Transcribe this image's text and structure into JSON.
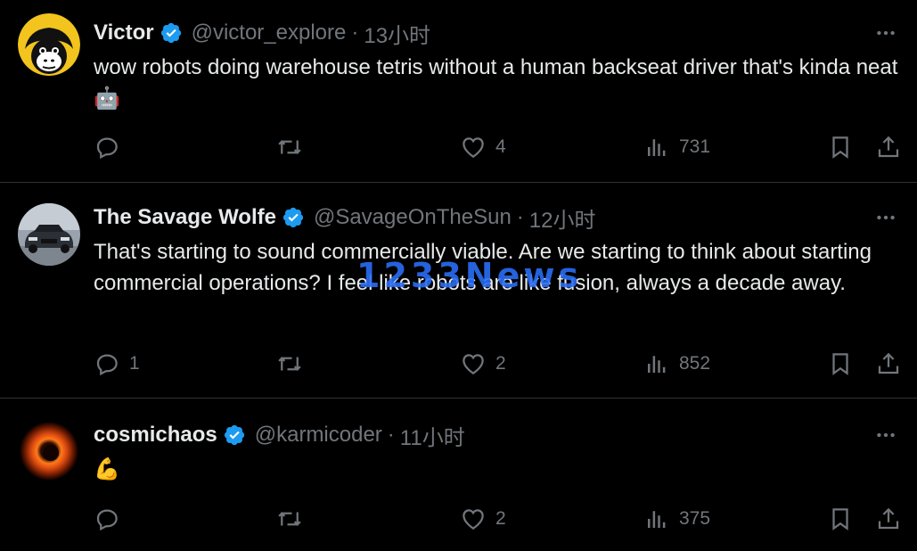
{
  "watermark": "1233News",
  "tweets": [
    {
      "name": "Victor",
      "handle": "@victor_explore",
      "separator": "·",
      "time": "13小时",
      "text": "wow robots doing warehouse tetris without a human backseat driver that's kinda neat 🤖",
      "reply_count": "",
      "retweet_count": "",
      "like_count": "4",
      "view_count": "731",
      "avatar": "gorilla-avatar",
      "verified": true
    },
    {
      "name": "The Savage Wolfe",
      "handle": "@SavageOnTheSun",
      "separator": "·",
      "time": "12小时",
      "text": "That's starting to sound commercially viable.  Are we starting to think about starting commercial operations?  I feel like robots are like fusion, always a decade away.",
      "reply_count": "1",
      "retweet_count": "",
      "like_count": "2",
      "view_count": "852",
      "avatar": "car-avatar",
      "verified": true
    },
    {
      "name": "cosmichaos",
      "handle": "@karmicoder",
      "separator": "·",
      "time": "11小时",
      "text": "💪",
      "reply_count": "",
      "retweet_count": "",
      "like_count": "2",
      "view_count": "375",
      "avatar": "black-hole-avatar",
      "verified": true
    }
  ],
  "colors": {
    "background": "#000000",
    "text": "#e7e9ea",
    "muted": "#71767b",
    "verified": "#1d9bf0",
    "divider": "#2f3336"
  },
  "icons": [
    "reply-icon",
    "retweet-icon",
    "like-icon",
    "views-icon",
    "bookmark-icon",
    "share-icon",
    "more-icon",
    "verified-badge-icon"
  ]
}
